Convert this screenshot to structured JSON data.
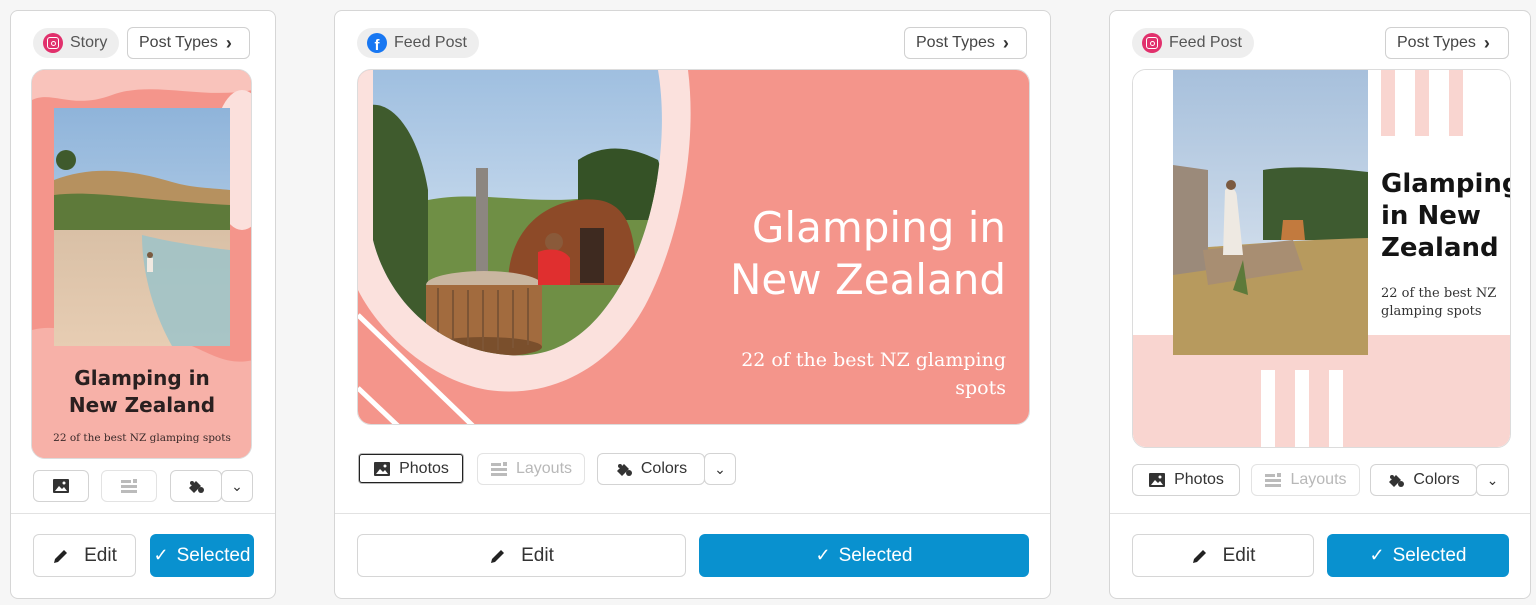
{
  "cards": [
    {
      "platform_label": "Story",
      "post_types_label": "Post Types",
      "design": {
        "title_line1": "Glamping in",
        "title_line2": "New Zealand",
        "subtitle": "22 of the best NZ glamping spots"
      },
      "edit_label": "Edit",
      "selected_label": "Selected"
    },
    {
      "platform_label": "Feed Post",
      "post_types_label": "Post Types",
      "design": {
        "title_line1": "Glamping in",
        "title_line2": "New Zealand",
        "subtitle_line1": "22 of the best NZ glamping",
        "subtitle_line2": "spots"
      },
      "tools": {
        "photos": "Photos",
        "layouts": "Layouts",
        "colors": "Colors"
      },
      "edit_label": "Edit",
      "selected_label": "Selected"
    },
    {
      "platform_label": "Feed Post",
      "post_types_label": "Post Types",
      "design": {
        "title_line1": "Glamping",
        "title_line2": "in New",
        "title_line3": "Zealand",
        "subtitle_line1": "22 of the best NZ",
        "subtitle_line2": "glamping spots"
      },
      "tools": {
        "photos": "Photos",
        "layouts": "Layouts",
        "colors": "Colors"
      },
      "edit_label": "Edit",
      "selected_label": "Selected"
    }
  ],
  "colors": {
    "accent": "#0991cf",
    "salmon": "#f4958b",
    "pink_light": "#f9d5d0",
    "instagram": "#e1306c",
    "facebook": "#1877f2"
  },
  "icons": {
    "photos": "image-icon",
    "layouts": "layout-icon",
    "colors": "palette-icon",
    "edit": "pencil-icon",
    "selected": "check-icon",
    "more": "chevron-down-icon",
    "post_types": "chevron-right-icon"
  }
}
